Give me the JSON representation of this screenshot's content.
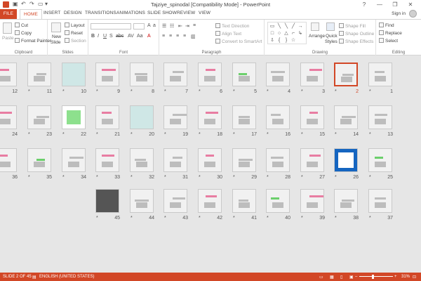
{
  "window": {
    "title": "Tajziye_spinodal [Compatibility Mode] - PowerPoint",
    "controls": [
      "?",
      "—",
      "❐",
      "✕"
    ]
  },
  "tabs": {
    "file": "FILE",
    "items": [
      "HOME",
      "INSERT",
      "DESIGN",
      "TRANSITIONS",
      "ANIMATIONS",
      "SLIDE SHOW",
      "REVIEW",
      "VIEW"
    ],
    "active": "HOME"
  },
  "account": {
    "signin": "Sign in"
  },
  "ribbon": {
    "clipboard": {
      "paste": "Paste",
      "cut": "Cut",
      "copy": "Copy",
      "format_painter": "Format Painter",
      "label": "Clipboard"
    },
    "slides": {
      "new_slide": "New",
      "new_slide_2": "Slide",
      "layout": "Layout",
      "reset": "Reset",
      "section": "Section",
      "label": "Slides"
    },
    "font": {
      "label": "Font"
    },
    "paragraph": {
      "text_direction": "Text Direction",
      "align_text": "Align Text",
      "convert": "Convert to SmartArt",
      "label": "Paragraph"
    },
    "drawing": {
      "arrange": "Arrange",
      "quick_styles": "Quick",
      "quick_styles_2": "Styles",
      "shape_fill": "Shape Fill",
      "shape_outline": "Shape Outline",
      "shape_effects": "Shape Effects",
      "label": "Drawing"
    },
    "editing": {
      "find": "Find",
      "replace": "Replace",
      "select": "Select",
      "label": "Editing"
    }
  },
  "slides": {
    "selected": 2,
    "star": "*",
    "numbers": [
      1,
      2,
      3,
      4,
      5,
      6,
      7,
      8,
      9,
      10,
      11,
      12,
      13,
      14,
      15,
      16,
      17,
      18,
      19,
      20,
      21,
      22,
      23,
      24,
      25,
      26,
      27,
      28,
      29,
      30,
      31,
      32,
      33,
      34,
      35,
      36,
      37,
      38,
      39,
      40,
      41,
      42,
      43,
      44,
      45
    ]
  },
  "status": {
    "slide": "SLIDE 2 OF 45",
    "language": "ENGLISH (UNITED STATES)",
    "zoom": "31%"
  },
  "colors": {
    "accent": "#d24726",
    "background": "#e6e6e6"
  }
}
